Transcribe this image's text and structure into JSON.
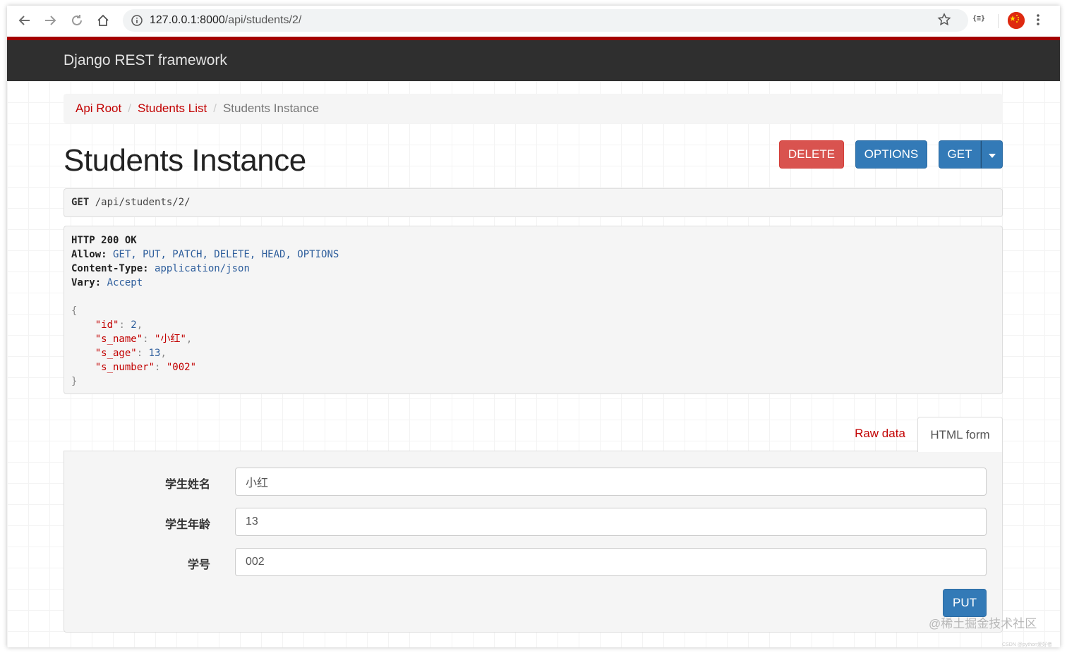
{
  "browser": {
    "url_host": "127.0.0.1:8000",
    "url_path": "/api/students/2/",
    "icons": [
      "back-arrow-icon",
      "forward-arrow-icon",
      "reload-icon",
      "home-icon",
      "info-icon",
      "star-icon",
      "json-viewer-extension-icon",
      "profile-avatar",
      "kebab-menu-icon"
    ],
    "extension_label": "{≡}"
  },
  "navbar": {
    "brand": "Django REST framework"
  },
  "breadcrumb": {
    "items": [
      "Api Root",
      "Students List"
    ],
    "separator": "/",
    "active": "Students Instance"
  },
  "page": {
    "title": "Students Instance"
  },
  "actions": {
    "delete": "DELETE",
    "options": "OPTIONS",
    "get": "GET"
  },
  "request": {
    "method": "GET",
    "path": "/api/students/2/"
  },
  "response": {
    "status": "HTTP 200 OK",
    "headers": [
      {
        "name": "Allow:",
        "value": "GET, PUT, PATCH, DELETE, HEAD, OPTIONS"
      },
      {
        "name": "Content-Type:",
        "value": "application/json"
      },
      {
        "name": "Vary:",
        "value": "Accept"
      }
    ],
    "body": [
      {
        "key": "\"id\"",
        "value": "2",
        "type": "num",
        "comma": true
      },
      {
        "key": "\"s_name\"",
        "value": "\"小红\"",
        "type": "str",
        "comma": true
      },
      {
        "key": "\"s_age\"",
        "value": "13",
        "type": "num",
        "comma": true
      },
      {
        "key": "\"s_number\"",
        "value": "\"002\"",
        "type": "str",
        "comma": false
      }
    ]
  },
  "tabs": {
    "raw": "Raw data",
    "html": "HTML form"
  },
  "form": {
    "fields": [
      {
        "label": "学生姓名",
        "value": "小红"
      },
      {
        "label": "学生年龄",
        "value": "13"
      },
      {
        "label": "学号",
        "value": "002"
      }
    ],
    "submit": "PUT"
  },
  "watermark": {
    "text": "@稀土掘金技术社区",
    "small": "CSDN @python爱好者"
  },
  "colors": {
    "accent_red": "#c20000",
    "navbar_bg": "#2f2f2f",
    "primary": "#337ab7",
    "danger": "#d9534f"
  }
}
